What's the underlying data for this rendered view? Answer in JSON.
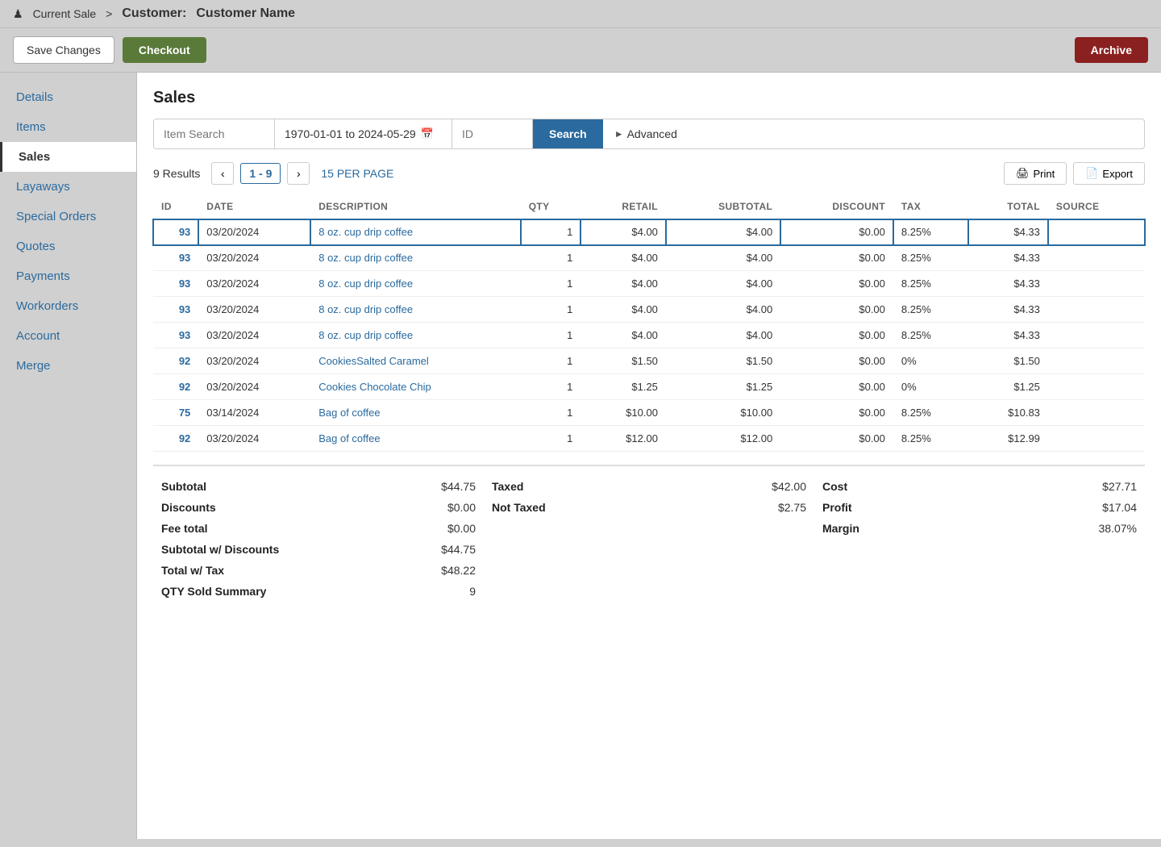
{
  "topbar": {
    "person_icon": "♟",
    "current_sale": "Current Sale",
    "separator": ">",
    "customer_label": "Customer:",
    "customer_name": "Customer Name"
  },
  "actionbar": {
    "save_changes": "Save Changes",
    "checkout": "Checkout",
    "archive": "Archive"
  },
  "sidebar": {
    "items": [
      {
        "id": "details",
        "label": "Details",
        "active": false
      },
      {
        "id": "items",
        "label": "Items",
        "active": false
      },
      {
        "id": "sales",
        "label": "Sales",
        "active": true
      },
      {
        "id": "layaways",
        "label": "Layaways",
        "active": false
      },
      {
        "id": "special-orders",
        "label": "Special Orders",
        "active": false
      },
      {
        "id": "quotes",
        "label": "Quotes",
        "active": false
      },
      {
        "id": "payments",
        "label": "Payments",
        "active": false
      },
      {
        "id": "workorders",
        "label": "Workorders",
        "active": false
      },
      {
        "id": "account",
        "label": "Account",
        "active": false
      },
      {
        "id": "merge",
        "label": "Merge",
        "active": false
      }
    ]
  },
  "main": {
    "title": "Sales",
    "search": {
      "item_placeholder": "Item Search",
      "date_value": "1970-01-01 to 2024-05-29",
      "id_placeholder": "ID",
      "search_label": "Search",
      "advanced_label": "Advanced"
    },
    "results": {
      "count": "9 Results",
      "page": "1 - 9",
      "per_page": "15 PER PAGE",
      "print": "Print",
      "export": "Export"
    },
    "table": {
      "columns": [
        "ID",
        "DATE",
        "DESCRIPTION",
        "QTY",
        "RETAIL",
        "SUBTOTAL",
        "DISCOUNT",
        "TAX",
        "TOTAL",
        "SOURCE"
      ],
      "rows": [
        {
          "id": "93",
          "date": "03/20/2024",
          "description": "8 oz. cup drip coffee",
          "qty": "1",
          "retail": "$4.00",
          "subtotal": "$4.00",
          "discount": "$0.00",
          "tax": "8.25%",
          "total": "$4.33",
          "source": "",
          "selected": true
        },
        {
          "id": "93",
          "date": "03/20/2024",
          "description": "8 oz. cup drip coffee",
          "qty": "1",
          "retail": "$4.00",
          "subtotal": "$4.00",
          "discount": "$0.00",
          "tax": "8.25%",
          "total": "$4.33",
          "source": "",
          "selected": false
        },
        {
          "id": "93",
          "date": "03/20/2024",
          "description": "8 oz. cup drip coffee",
          "qty": "1",
          "retail": "$4.00",
          "subtotal": "$4.00",
          "discount": "$0.00",
          "tax": "8.25%",
          "total": "$4.33",
          "source": "",
          "selected": false
        },
        {
          "id": "93",
          "date": "03/20/2024",
          "description": "8 oz. cup drip coffee",
          "qty": "1",
          "retail": "$4.00",
          "subtotal": "$4.00",
          "discount": "$0.00",
          "tax": "8.25%",
          "total": "$4.33",
          "source": "",
          "selected": false
        },
        {
          "id": "93",
          "date": "03/20/2024",
          "description": "8 oz. cup drip coffee",
          "qty": "1",
          "retail": "$4.00",
          "subtotal": "$4.00",
          "discount": "$0.00",
          "tax": "8.25%",
          "total": "$4.33",
          "source": "",
          "selected": false
        },
        {
          "id": "92",
          "date": "03/20/2024",
          "description": "CookiesSalted Caramel",
          "qty": "1",
          "retail": "$1.50",
          "subtotal": "$1.50",
          "discount": "$0.00",
          "tax": "0%",
          "total": "$1.50",
          "source": "",
          "selected": false
        },
        {
          "id": "92",
          "date": "03/20/2024",
          "description": "Cookies Chocolate Chip",
          "qty": "1",
          "retail": "$1.25",
          "subtotal": "$1.25",
          "discount": "$0.00",
          "tax": "0%",
          "total": "$1.25",
          "source": "",
          "selected": false
        },
        {
          "id": "75",
          "date": "03/14/2024",
          "description": "Bag of coffee",
          "qty": "1",
          "retail": "$10.00",
          "subtotal": "$10.00",
          "discount": "$0.00",
          "tax": "8.25%",
          "total": "$10.83",
          "source": "",
          "selected": false
        },
        {
          "id": "92",
          "date": "03/20/2024",
          "description": "Bag of coffee",
          "qty": "1",
          "retail": "$12.00",
          "subtotal": "$12.00",
          "discount": "$0.00",
          "tax": "8.25%",
          "total": "$12.99",
          "source": "",
          "selected": false
        }
      ]
    },
    "summary": {
      "subtotal_label": "Subtotal",
      "subtotal_value": "$44.75",
      "discounts_label": "Discounts",
      "discounts_value": "$0.00",
      "fee_total_label": "Fee total",
      "fee_total_value": "$0.00",
      "subtotal_discounts_label": "Subtotal w/ Discounts",
      "subtotal_discounts_value": "$44.75",
      "total_tax_label": "Total w/ Tax",
      "total_tax_value": "$48.22",
      "qty_sold_label": "QTY Sold Summary",
      "qty_sold_value": "9",
      "taxed_label": "Taxed",
      "taxed_value": "$42.00",
      "not_taxed_label": "Not Taxed",
      "not_taxed_value": "$2.75",
      "cost_label": "Cost",
      "cost_value": "$27.71",
      "profit_label": "Profit",
      "profit_value": "$17.04",
      "margin_label": "Margin",
      "margin_value": "38.07%"
    }
  }
}
